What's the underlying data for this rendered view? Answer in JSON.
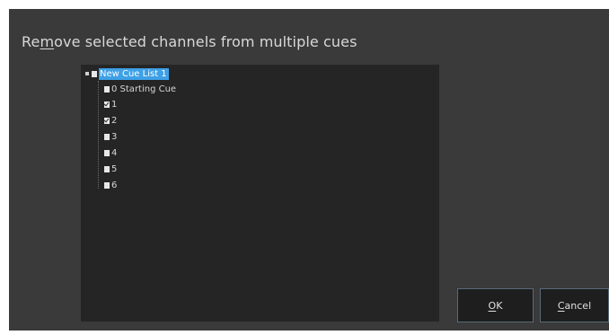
{
  "dialog": {
    "title_pre": "Re",
    "title_accel": "m",
    "title_post": "ove selected channels from multiple cues"
  },
  "tree": {
    "root": {
      "label": "New Cue List 1",
      "checked": false,
      "selected": true
    },
    "children": [
      {
        "label": "0 Starting Cue",
        "checked": false
      },
      {
        "label": "1",
        "checked": true
      },
      {
        "label": "2",
        "checked": true
      },
      {
        "label": "3",
        "checked": false
      },
      {
        "label": "4",
        "checked": false
      },
      {
        "label": "5",
        "checked": false
      },
      {
        "label": "6",
        "checked": false
      }
    ]
  },
  "buttons": {
    "ok_accel": "O",
    "ok_rest": "K",
    "cancel_accel": "C",
    "cancel_rest": "ancel"
  }
}
